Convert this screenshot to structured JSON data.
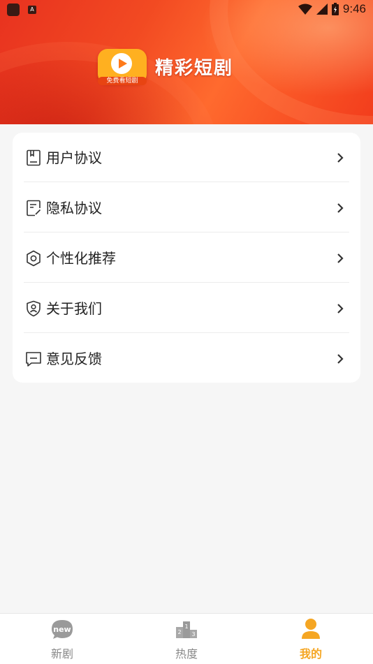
{
  "status_bar": {
    "time": "9:46"
  },
  "header": {
    "logo_subtitle": "免费看短剧",
    "app_title": "精彩短剧"
  },
  "menu": {
    "items": [
      {
        "label": "用户协议",
        "icon": "document-icon"
      },
      {
        "label": "隐私协议",
        "icon": "privacy-document-icon"
      },
      {
        "label": "个性化推荐",
        "icon": "settings-gear-icon"
      },
      {
        "label": "关于我们",
        "icon": "shield-user-icon"
      },
      {
        "label": "意见反馈",
        "icon": "feedback-message-icon"
      }
    ]
  },
  "tabbar": {
    "tabs": [
      {
        "label": "新剧",
        "icon": "new-badge-icon",
        "active": false
      },
      {
        "label": "热度",
        "icon": "ranking-podium-icon",
        "active": false
      },
      {
        "label": "我的",
        "icon": "user-icon",
        "active": true
      }
    ]
  },
  "colors": {
    "accent": "#f5a623",
    "header_red": "#f24a22"
  }
}
